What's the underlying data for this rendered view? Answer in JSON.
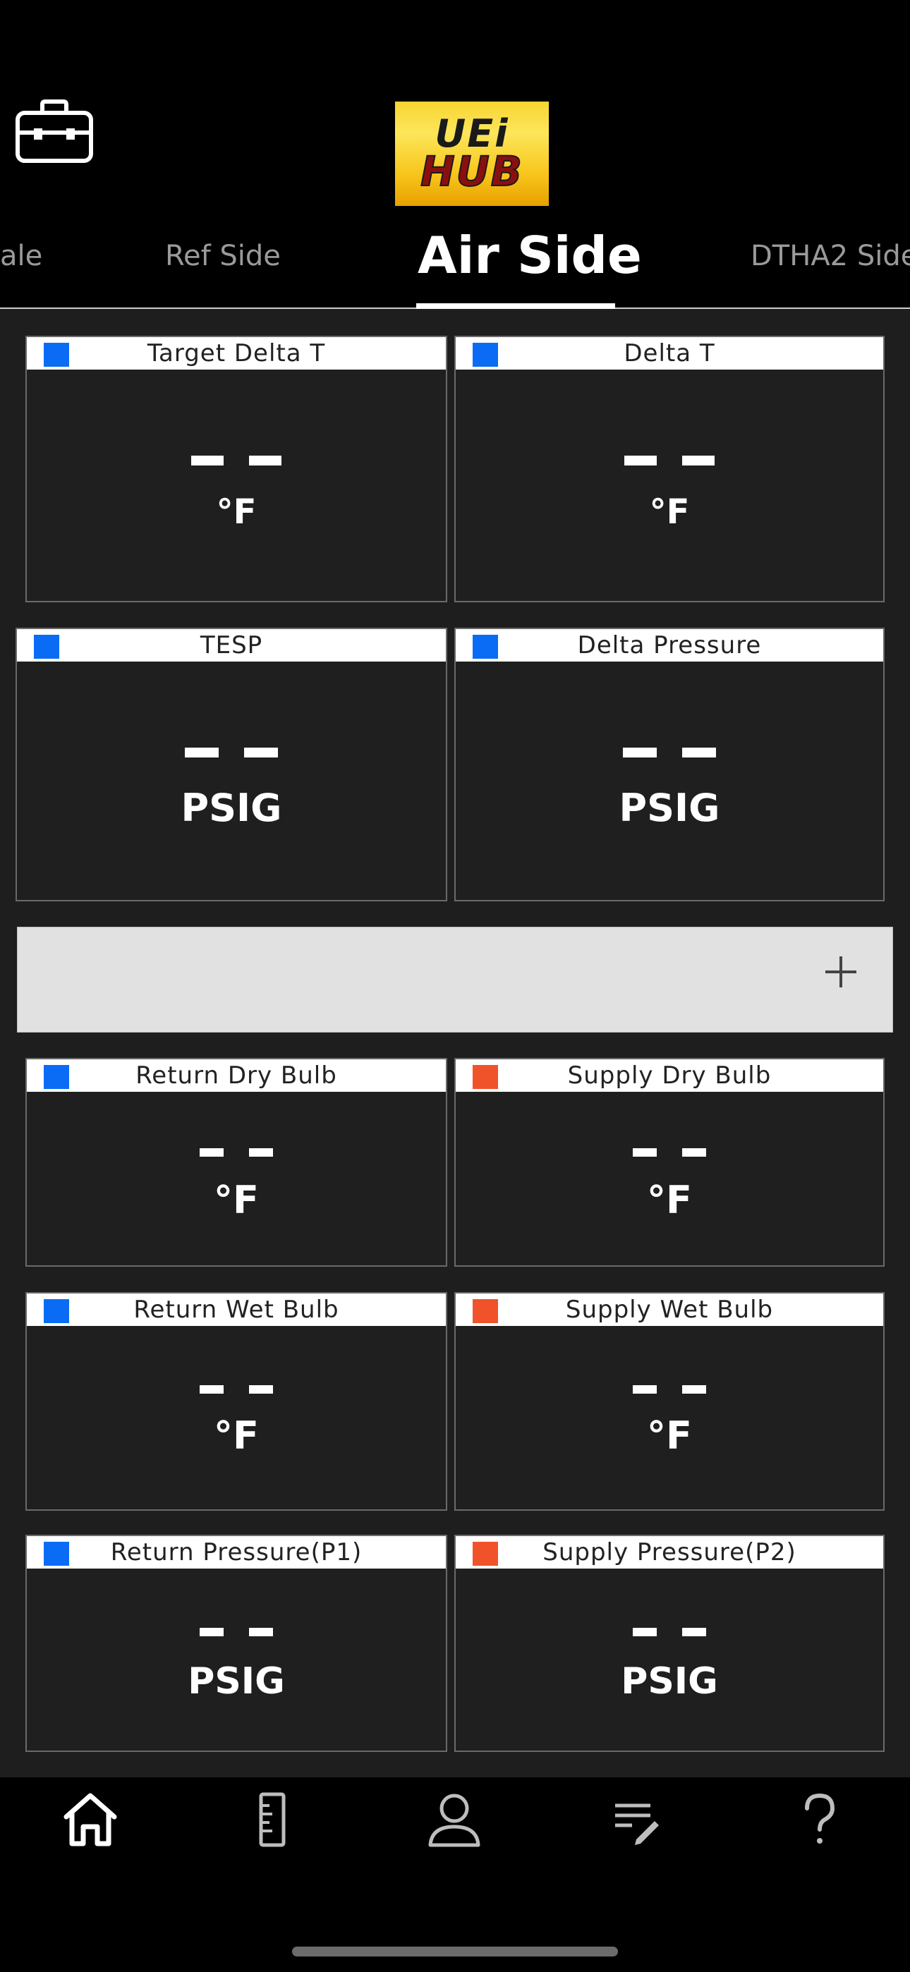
{
  "app": {
    "logo_line1": "UEi",
    "logo_line2": "HUB"
  },
  "tabs": [
    {
      "label": "ale"
    },
    {
      "label": "Ref Side"
    },
    {
      "label": "Air Side",
      "active": true
    },
    {
      "label": "DTHA2 Side"
    }
  ],
  "colors": {
    "blue": "#0a6cf5",
    "orange": "#f0532a"
  },
  "cards": [
    {
      "title": "Target Delta T",
      "value": "– –",
      "unit": "°F",
      "color": "blue"
    },
    {
      "title": "Delta T",
      "value": "– –",
      "unit": "°F",
      "color": "blue"
    },
    {
      "title": "TESP",
      "value": "– –",
      "unit": "PSIG",
      "color": "blue"
    },
    {
      "title": "Delta Pressure",
      "value": "– –",
      "unit": "PSIG",
      "color": "blue"
    },
    {
      "title": "Return Dry Bulb",
      "value": "– –",
      "unit": "°F",
      "color": "blue"
    },
    {
      "title": "Supply Dry Bulb",
      "value": "– –",
      "unit": "°F",
      "color": "orange"
    },
    {
      "title": "Return Wet Bulb",
      "value": "– –",
      "unit": "°F",
      "color": "blue"
    },
    {
      "title": "Supply Wet Bulb",
      "value": "– –",
      "unit": "°F",
      "color": "orange"
    },
    {
      "title": "Return Pressure(P1)",
      "value": "– –",
      "unit": "PSIG",
      "color": "blue"
    },
    {
      "title": "Supply Pressure(P2)",
      "value": "– –",
      "unit": "PSIG",
      "color": "orange"
    }
  ],
  "add_section": {
    "icon": "plus-icon"
  },
  "bottom_nav": [
    {
      "icon": "home-icon",
      "active": true
    },
    {
      "icon": "ruler-icon"
    },
    {
      "icon": "person-icon"
    },
    {
      "icon": "notes-edit-icon"
    },
    {
      "icon": "help-icon"
    }
  ]
}
